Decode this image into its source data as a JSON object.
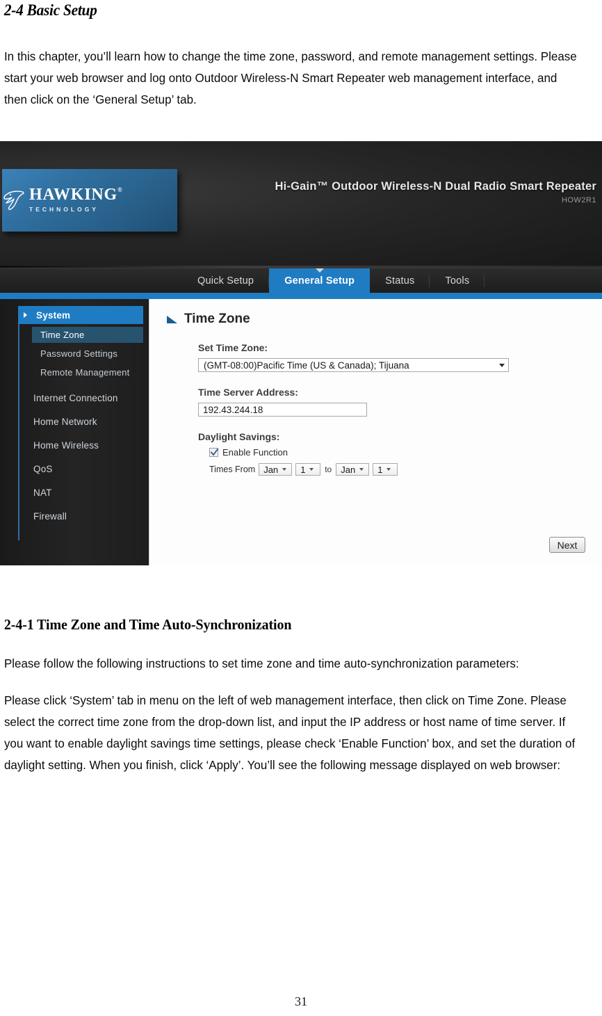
{
  "document": {
    "heading_major": "2-4 Basic Setup",
    "intro_paragraph": "In this chapter, you’ll learn how to change the time zone, password, and remote management settings. Please start your web browser and log onto Outdoor Wireless-N Smart Repeater web management interface, and then click on the ‘General Setup’ tab.",
    "heading_minor": "2-4-1 Time Zone and Time Auto-Synchronization",
    "paragraph_2": "Please follow the following instructions to set time zone and time auto-synchronization parameters:",
    "paragraph_3": "Please click ‘System’ tab in menu on the left of web management interface, then click on Time Zone.    Please select the correct time zone from the drop-down list, and input the IP address or host name of time server. If you want to enable daylight savings time settings, please check ‘Enable Function’ box, and set the duration of daylight setting. When you finish, click ‘Apply’. You’ll see the following message displayed on web browser:",
    "page_number": "31"
  },
  "screenshot": {
    "header": {
      "logo_main": "HAWKIN",
      "logo_main_tail": "G",
      "logo_registered": "®",
      "logo_sub": "TECHNOLOGY",
      "product_title": "Hi-Gain™ Outdoor Wireless-N Dual Radio Smart Repeater",
      "model": "HOW2R1"
    },
    "tabs": [
      {
        "label": "Quick Setup",
        "active": false
      },
      {
        "label": "General Setup",
        "active": true
      },
      {
        "label": "Status",
        "active": false
      },
      {
        "label": "Tools",
        "active": false
      }
    ],
    "sidebar": {
      "group": "System",
      "sub_items": [
        {
          "label": "Time Zone",
          "selected": true
        },
        {
          "label": "Password Settings",
          "selected": false
        },
        {
          "label": "Remote Management",
          "selected": false
        }
      ],
      "items": [
        {
          "label": "Internet Connection"
        },
        {
          "label": "Home Network"
        },
        {
          "label": "Home Wireless"
        },
        {
          "label": "QoS"
        },
        {
          "label": "NAT"
        },
        {
          "label": "Firewall"
        }
      ]
    },
    "content": {
      "title": "Time Zone",
      "set_time_zone_label": "Set Time Zone:",
      "set_time_zone_value": "(GMT-08:00)Pacific Time (US & Canada); Tijuana",
      "time_server_label": "Time Server Address:",
      "time_server_value": "192.43.244.18",
      "daylight_label": "Daylight Savings:",
      "enable_function_label": "Enable Function",
      "times_from_label": "Times From",
      "from_month": "Jan",
      "from_day": "1",
      "to_word": "to",
      "to_month": "Jan",
      "to_day": "1",
      "next_button": "Next"
    },
    "colors": {
      "accent_blue": "#1f7cc2",
      "header_dark": "#242424",
      "sidebar_dark": "#1e1e1e",
      "selected_sub": "#27536f"
    }
  }
}
